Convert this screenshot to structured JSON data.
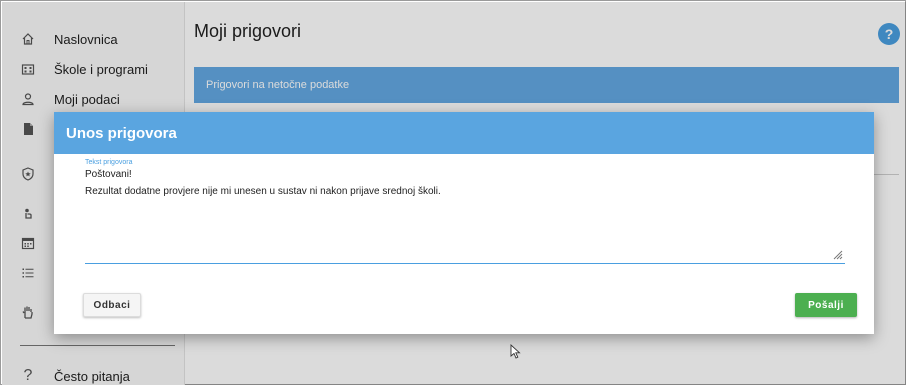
{
  "sidebar": {
    "items": [
      {
        "label": "Naslovnica",
        "icon": "home-icon"
      },
      {
        "label": "Škole i programi",
        "icon": "building-icon"
      },
      {
        "label": "Moji podaci",
        "icon": "person-icon"
      },
      {
        "label": "",
        "icon": "document-icon"
      },
      {
        "label": "",
        "icon": "shield-star-icon"
      },
      {
        "label": "",
        "icon": "touch-icon"
      },
      {
        "label": "",
        "icon": "calendar-icon"
      },
      {
        "label": "",
        "icon": "list-icon"
      },
      {
        "label": "",
        "icon": "hand-icon"
      }
    ],
    "faq": {
      "label": "Često pitanja",
      "icon": "question-icon"
    }
  },
  "main": {
    "title": "Moji prigovori",
    "help_label": "?",
    "panel_title": "Prigovori na netočne podatke"
  },
  "dialog": {
    "title": "Unos prigovora",
    "field_label": "Tekst prigovora",
    "text_line1": "Poštovani!",
    "text_line2": "Rezultat dodatne provjere nije mi unesen u sustav ni nakon prijave srednoj školi.",
    "discard_label": "Odbaci",
    "send_label": "Pošalji"
  },
  "colors": {
    "primary": "#5aa5e0",
    "success": "#4caf50",
    "help": "#4a9fe0"
  }
}
